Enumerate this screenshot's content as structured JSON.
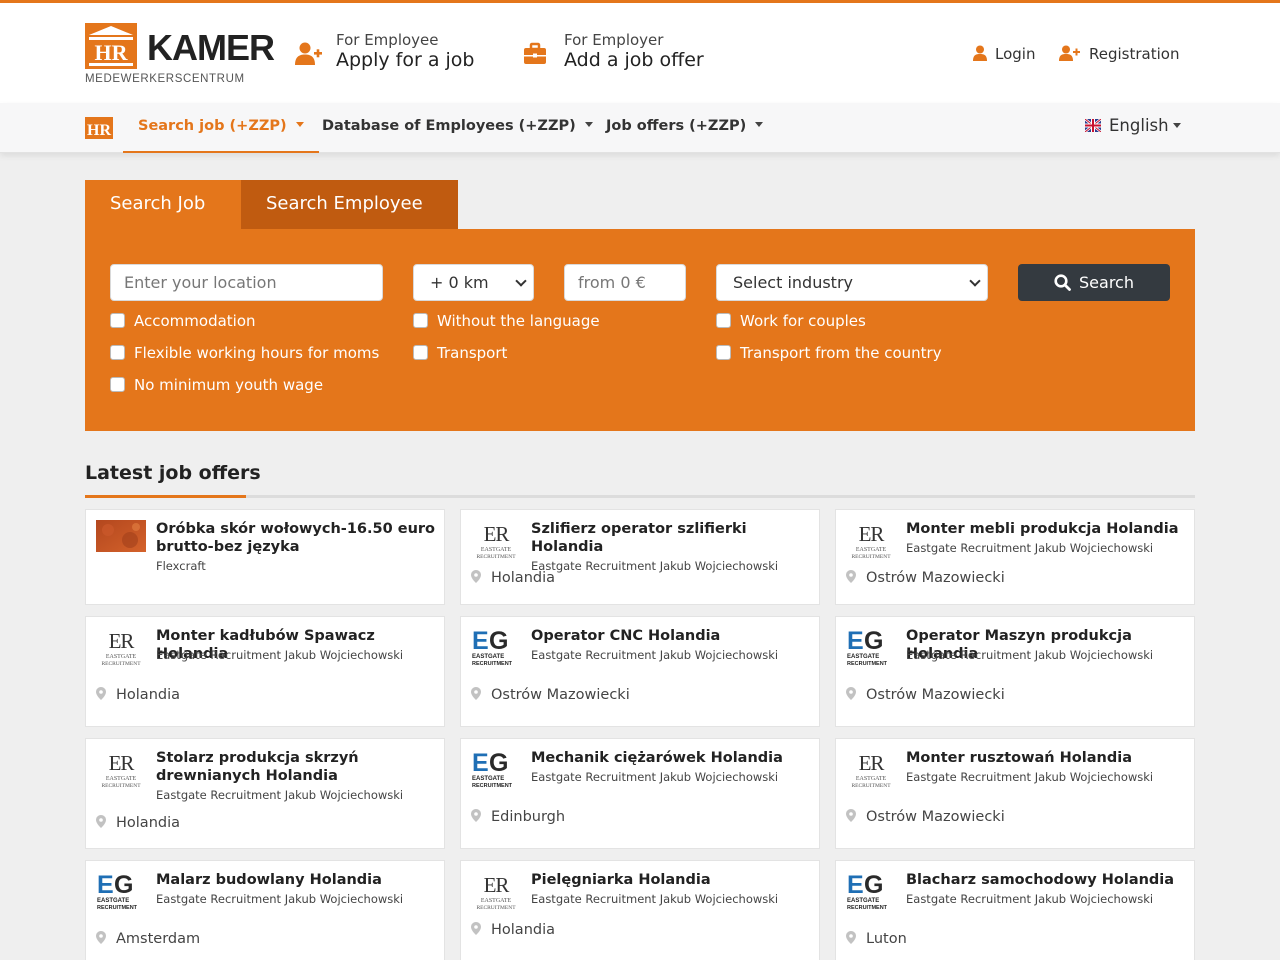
{
  "brand": {
    "logo_badge": "HR",
    "name": "KAMER",
    "tagline": "MEDEWERKERSCENTRUM",
    "accent_color": "#e4761b",
    "dark_tab_color": "#c05b10"
  },
  "header": {
    "employee": {
      "small": "For Employee",
      "big": "Apply for a job",
      "icon": "user-plus-icon"
    },
    "employer": {
      "small": "For Employer",
      "big": "Add a job offer",
      "icon": "briefcase-icon"
    },
    "login": "Login",
    "registration": "Registration"
  },
  "nav": {
    "items": [
      {
        "label": "Search job (+ZZP)",
        "active": true
      },
      {
        "label": "Database of Employees (+ZZP)",
        "active": false
      },
      {
        "label": "Job offers (+ZZP)",
        "active": false
      }
    ],
    "language": "English"
  },
  "search": {
    "tabs": [
      "Search Job",
      "Search Employee"
    ],
    "location_placeholder": "Enter your location",
    "distance_value": "+ 0 km",
    "salary_placeholder": "from 0 €",
    "industry_value": "Select industry",
    "button": "Search",
    "checkboxes": [
      "Accommodation",
      "Without the language",
      "Work for couples",
      "Flexible working hours for moms",
      "Transport",
      "Transport from the country",
      "No minimum youth wage"
    ]
  },
  "latest": {
    "title": "Latest job offers",
    "offers": [
      {
        "title": "Oróbka skór wołowych-16.50 euro brutto-bez języka",
        "company": "Flexcraft",
        "location": "",
        "logo": "photo"
      },
      {
        "title": "Szlifierz operator szlifierki Holandia",
        "company": "Eastgate Recruitment Jakub Wojciechowski",
        "location": "Holandia",
        "logo": "ER"
      },
      {
        "title": "Monter mebli produkcja Holandia",
        "company": "Eastgate Recruitment Jakub Wojciechowski",
        "location": "Ostrów Mazowiecki",
        "logo": "ER"
      },
      {
        "title": "Monter kadłubów Spawacz Holandia",
        "company": "Eastgate Recruitment Jakub Wojciechowski",
        "location": "Holandia",
        "logo": "ER"
      },
      {
        "title": "Operator CNC Holandia",
        "company": "Eastgate Recruitment Jakub Wojciechowski",
        "location": "Ostrów Mazowiecki",
        "logo": "EG"
      },
      {
        "title": "Operator Maszyn produkcja Holandia",
        "company": "Eastgate Recruitment Jakub Wojciechowski",
        "location": "Ostrów Mazowiecki",
        "logo": "EG"
      },
      {
        "title": "Stolarz produkcja skrzyń drewnianych Holandia",
        "company": "Eastgate Recruitment Jakub Wojciechowski",
        "location": "Holandia",
        "logo": "ER"
      },
      {
        "title": "Mechanik ciężarówek Holandia",
        "company": "Eastgate Recruitment Jakub Wojciechowski",
        "location": "Edinburgh",
        "logo": "EG"
      },
      {
        "title": "Monter rusztowań Holandia",
        "company": "Eastgate Recruitment Jakub Wojciechowski",
        "location": "Ostrów Mazowiecki",
        "logo": "ER"
      },
      {
        "title": "Malarz budowlany Holandia",
        "company": "Eastgate Recruitment Jakub Wojciechowski",
        "location": "Amsterdam",
        "logo": "EG"
      },
      {
        "title": "Pielęgniarka Holandia",
        "company": "Eastgate Recruitment Jakub Wojciechowski",
        "location": "Holandia",
        "logo": "ER"
      },
      {
        "title": "Blacharz samochodowy Holandia",
        "company": "Eastgate Recruitment Jakub Wojciechowski",
        "location": "Luton",
        "logo": "EG"
      }
    ]
  },
  "logo_text": {
    "er_sub1": "EASTGATE",
    "er_sub2": "RECRUITMENT",
    "eg_sub1": "EASTGATE",
    "eg_sub2": "RECRUITMENT"
  }
}
